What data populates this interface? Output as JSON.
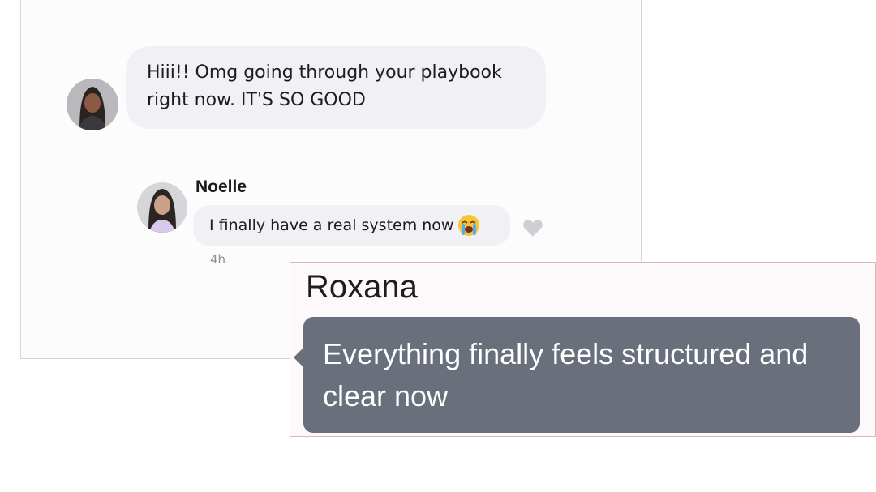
{
  "chat": {
    "message1": "Hiii!! Omg going through your playbook right now. IT'S SO GOOD",
    "reply": {
      "sender": "Noelle",
      "text": "I finally have a real system now",
      "emoji": "loudly-crying-face-emoji",
      "time": "4h",
      "like_icon": "heart-icon"
    }
  },
  "roxana": {
    "name": "Roxana",
    "message": "Everything finally feels structured and clear now"
  },
  "colors": {
    "bubble_light": "#f1f1f5",
    "bubble_dark": "#6a707b",
    "heart": "#cfcfd3"
  }
}
